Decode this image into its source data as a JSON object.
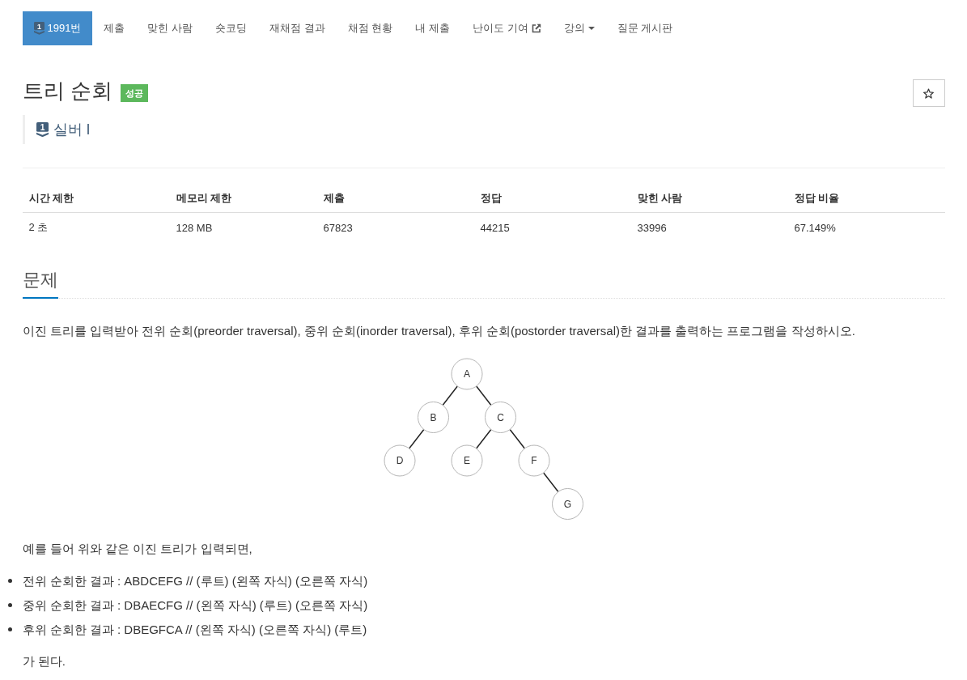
{
  "nav": {
    "tabs": [
      {
        "label": "1991번",
        "kind": "problem",
        "badge": "1",
        "selected": true
      },
      {
        "label": "제출",
        "kind": "link",
        "selected": false
      },
      {
        "label": "맞힌 사람",
        "kind": "link",
        "selected": false
      },
      {
        "label": "숏코딩",
        "kind": "link",
        "selected": false
      },
      {
        "label": "재채점 결과",
        "kind": "link",
        "selected": false
      },
      {
        "label": "채점 현황",
        "kind": "link",
        "selected": false
      },
      {
        "label": "내 제출",
        "kind": "link",
        "selected": false
      },
      {
        "label": "난이도 기여",
        "kind": "external",
        "selected": false
      },
      {
        "label": "강의",
        "kind": "dropdown",
        "selected": false
      },
      {
        "label": "질문 게시판",
        "kind": "link",
        "selected": false
      }
    ]
  },
  "header": {
    "title": "트리 순회",
    "result_label": "성공",
    "tier": {
      "badge": "1",
      "name": "실버 I"
    },
    "starred": false
  },
  "stats": {
    "columns": [
      "시간 제한",
      "메모리 제한",
      "제출",
      "정답",
      "맞힌 사람",
      "정답 비율"
    ],
    "rows": [
      [
        "2 초",
        "128 MB",
        "67823",
        "44215",
        "33996",
        "67.149%"
      ]
    ]
  },
  "problem": {
    "heading": "문제",
    "description": "이진 트리를 입력받아 전위 순회(preorder traversal), 중위 순회(inorder traversal), 후위 순회(postorder traversal)한 결과를 출력하는 프로그램을 작성하시오.",
    "tree": {
      "label": "A",
      "children": [
        {
          "label": "B",
          "kind": "left",
          "children": [
            {
              "label": "D",
              "kind": "left"
            }
          ]
        },
        {
          "label": "C",
          "kind": "right",
          "children": [
            {
              "label": "E",
              "kind": "left"
            },
            {
              "label": "F",
              "kind": "right",
              "children": [
                {
                  "label": "G",
                  "kind": "right"
                }
              ]
            }
          ]
        }
      ]
    },
    "example_intro": "예를 들어 위와 같은 이진 트리가 입력되면,",
    "results": [
      "전위 순회한 결과 : ABDCEFG // (루트) (왼쪽 자식) (오른쪽 자식)",
      "중위 순회한 결과 : DBAECFG // (왼쪽 자식) (루트) (오른쪽 자식)",
      "후위 순회한 결과 : DBEGFCA // (왼쪽 자식) (오른쪽 자식) (루트)"
    ],
    "conclusion": "가 된다."
  }
}
